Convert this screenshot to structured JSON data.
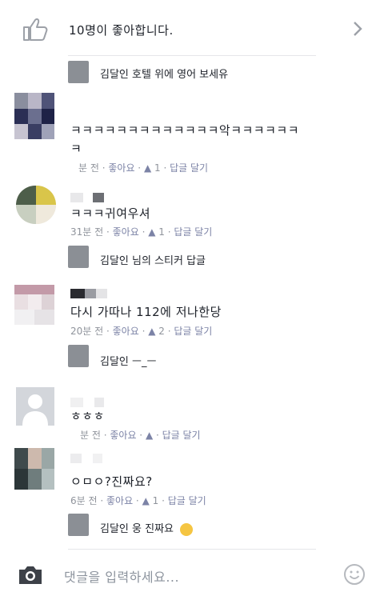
{
  "likes": {
    "text": "10명이 좋아합니다."
  },
  "pinned_reply": {
    "text": "김달인 호텔 위에 영어 보세유"
  },
  "comments": [
    {
      "text": "ㅋㅋㅋㅋㅋㅋㅋㅋㅋㅋㅋㅋㅋ악ㅋㅋㅋㅋㅋㅋ",
      "text2": "ㅋ",
      "meta": {
        "time": "분 전",
        "like": "좋아요",
        "count": "1",
        "reply": "답글 달기"
      }
    },
    {
      "text": "ㅋㅋㅋ귀여우셔",
      "meta": {
        "time": "31분 전",
        "like": "좋아요",
        "count": "1",
        "reply": "답글 달기"
      },
      "reply": "김달인 님의 스티커 답글"
    },
    {
      "text": "다시 가따나 112에 저나한당",
      "meta": {
        "time": "20분 전",
        "like": "좋아요",
        "count": "2",
        "reply": "답글 달기"
      },
      "reply": "김달인 ㅡ_ㅡ"
    },
    {
      "text": "ㅎㅎㅎ",
      "meta": {
        "time": "분 전",
        "like": "좋아요",
        "reply": "답글 달기"
      }
    },
    {
      "text": "ㅇㅁㅇ?진짜요?",
      "meta": {
        "time": "6분 전",
        "like": "좋아요",
        "count": "1",
        "reply": "답글 달기"
      },
      "reply": "김달인 웅 진짜요"
    }
  ],
  "composer": {
    "placeholder": "댓글을 입력하세요..."
  },
  "colors": {
    "link": "#7c83a6",
    "meta": "#90949c",
    "divider": "#e5e6ea"
  }
}
